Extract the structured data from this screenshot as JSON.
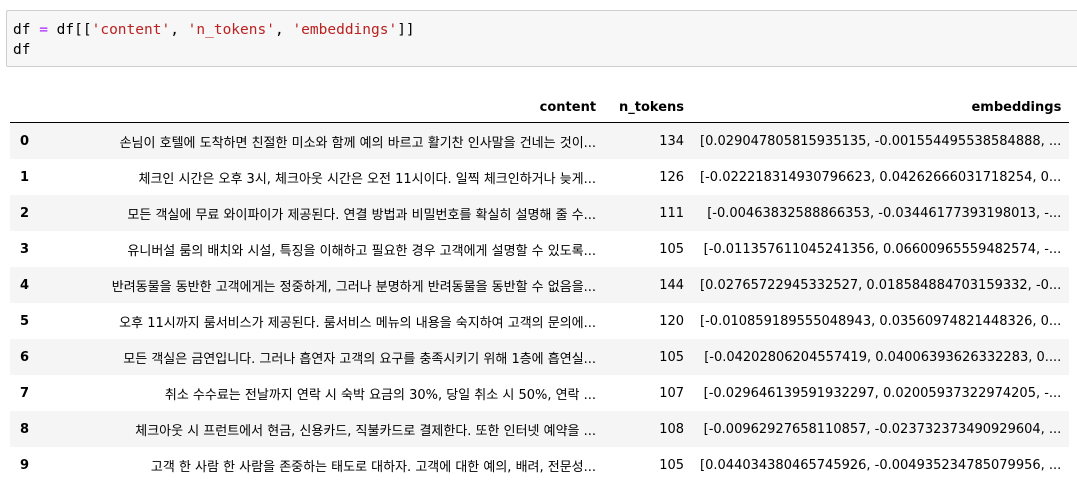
{
  "code_cell": {
    "line1": {
      "var": "df",
      "op": "=",
      "obj": "df",
      "open": "[[",
      "str1": "'content'",
      "sep1": ", ",
      "str2": "'n_tokens'",
      "sep2": ", ",
      "str3": "'embeddings'",
      "close": "]]"
    },
    "line2": "df"
  },
  "dataframe": {
    "index_header": "",
    "columns": [
      "content",
      "n_tokens",
      "embeddings"
    ],
    "rows": [
      {
        "index": "0",
        "content": "손님이 호텔에 도착하면 친절한 미소와 함께 예의 바르고 활기찬 인사말을 건네는 것이...",
        "n_tokens": "134",
        "embeddings": "[0.029047805815935135, -0.001554495538584888, ..."
      },
      {
        "index": "1",
        "content": "체크인 시간은 오후 3시, 체크아웃 시간은 오전 11시이다. 일찍 체크인하거나 늦게...",
        "n_tokens": "126",
        "embeddings": "[-0.022218314930796623, 0.04262666031718254, 0..."
      },
      {
        "index": "2",
        "content": "모든 객실에 무료 와이파이가 제공된다. 연결 방법과 비밀번호를 확실히 설명해 줄 수...",
        "n_tokens": "111",
        "embeddings": "[-0.00463832588866353, -0.03446177393198013, -..."
      },
      {
        "index": "3",
        "content": "유니버설 룸의 배치와 시설, 특징을 이해하고 필요한 경우 고객에게 설명할 수 있도록...",
        "n_tokens": "105",
        "embeddings": "[-0.011357611045241356, 0.06600965559482574, -..."
      },
      {
        "index": "4",
        "content": "반려동물을 동반한 고객에게는 정중하게, 그러나 분명하게 반려동물을 동반할 수 없음을...",
        "n_tokens": "144",
        "embeddings": "[0.02765722945332527, 0.018584884703159332, -0..."
      },
      {
        "index": "5",
        "content": "오후 11시까지 룸서비스가 제공된다. 룸서비스 메뉴의 내용을 숙지하여 고객의 문의에...",
        "n_tokens": "120",
        "embeddings": "[-0.010859189555048943, 0.03560974821448326, 0..."
      },
      {
        "index": "6",
        "content": "모든 객실은 금연입니다. 그러나 흡연자 고객의 요구를 충족시키기 위해 1층에 흡연실...",
        "n_tokens": "105",
        "embeddings": "[-0.04202806204557419, 0.04006393626332283, 0...."
      },
      {
        "index": "7",
        "content": "취소 수수료는 전날까지 연락 시 숙박 요금의 30%, 당일 취소 시 50%, 연락 ...",
        "n_tokens": "107",
        "embeddings": "[-0.029646139591932297, 0.02005937322974205, -..."
      },
      {
        "index": "8",
        "content": "체크아웃 시 프런트에서 현금, 신용카드, 직불카드로 결제한다. 또한 인터넷 예약을 ...",
        "n_tokens": "108",
        "embeddings": "[-0.00962927658110857, -0.023732373490929604, ..."
      },
      {
        "index": "9",
        "content": "고객 한 사람 한 사람을 존중하는 태도로 대하자. 고객에 대한 예의, 배려, 전문성...",
        "n_tokens": "105",
        "embeddings": "[0.044034380465745926, -0.004935234785079956, ..."
      }
    ]
  }
}
